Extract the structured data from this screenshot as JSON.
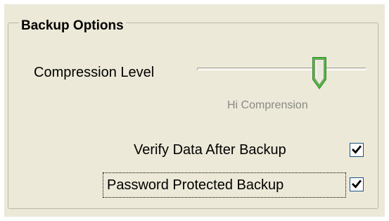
{
  "group": {
    "title": "Backup Options"
  },
  "compression": {
    "label": "Compression Level",
    "caption": "Hi Comprension",
    "level": 0.74
  },
  "verify": {
    "label": "Verify Data After Backup",
    "checked": true
  },
  "password": {
    "label": "Password Protected Backup",
    "checked": true
  },
  "icons": {
    "checkmark": "check-icon",
    "slider_thumb": "slider-thumb-icon"
  },
  "colors": {
    "panel_background": "#ece9d8",
    "thumb_accent": "#4cbb3c",
    "checkbox_border": "#1c5180",
    "caption_text": "#8a8a84"
  }
}
